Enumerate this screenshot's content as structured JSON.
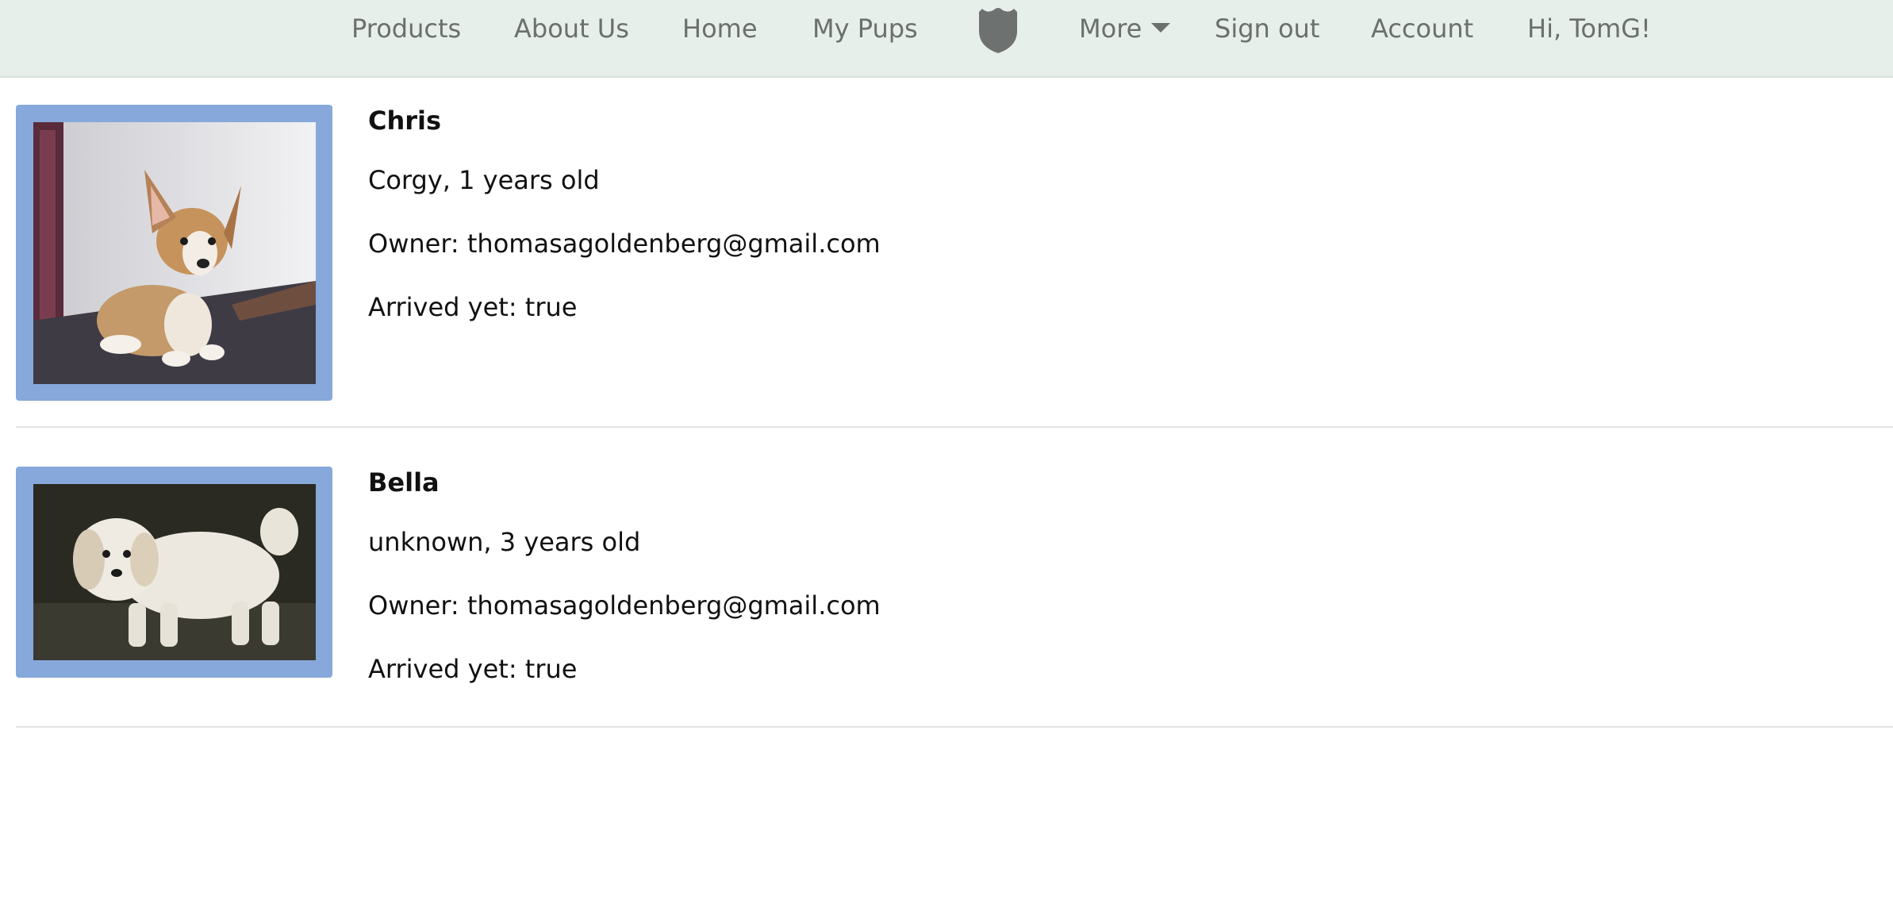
{
  "nav": {
    "items": [
      {
        "label": "Products"
      },
      {
        "label": "About Us"
      },
      {
        "label": "Home"
      },
      {
        "label": "My Pups"
      }
    ],
    "logo_icon": "shield-icon",
    "more": {
      "label": "More",
      "icon": "caret-down-icon"
    },
    "sign_out": "Sign out",
    "account": "Account",
    "greeting": "Hi, TomG!"
  },
  "pups": [
    {
      "name": "Chris",
      "breed_age": "Corgy, 1 years old",
      "owner": "Owner: thomasagoldenberg@gmail.com",
      "arrived": "Arrived yet: true"
    },
    {
      "name": "Bella",
      "breed_age": "unknown, 3 years old",
      "owner": "Owner: thomasagoldenberg@gmail.com",
      "arrived": "Arrived yet: true"
    }
  ],
  "colors": {
    "nav_bg": "#e6efe9",
    "photo_frame": "#87a8db",
    "nav_text": "#6b6f6d"
  }
}
